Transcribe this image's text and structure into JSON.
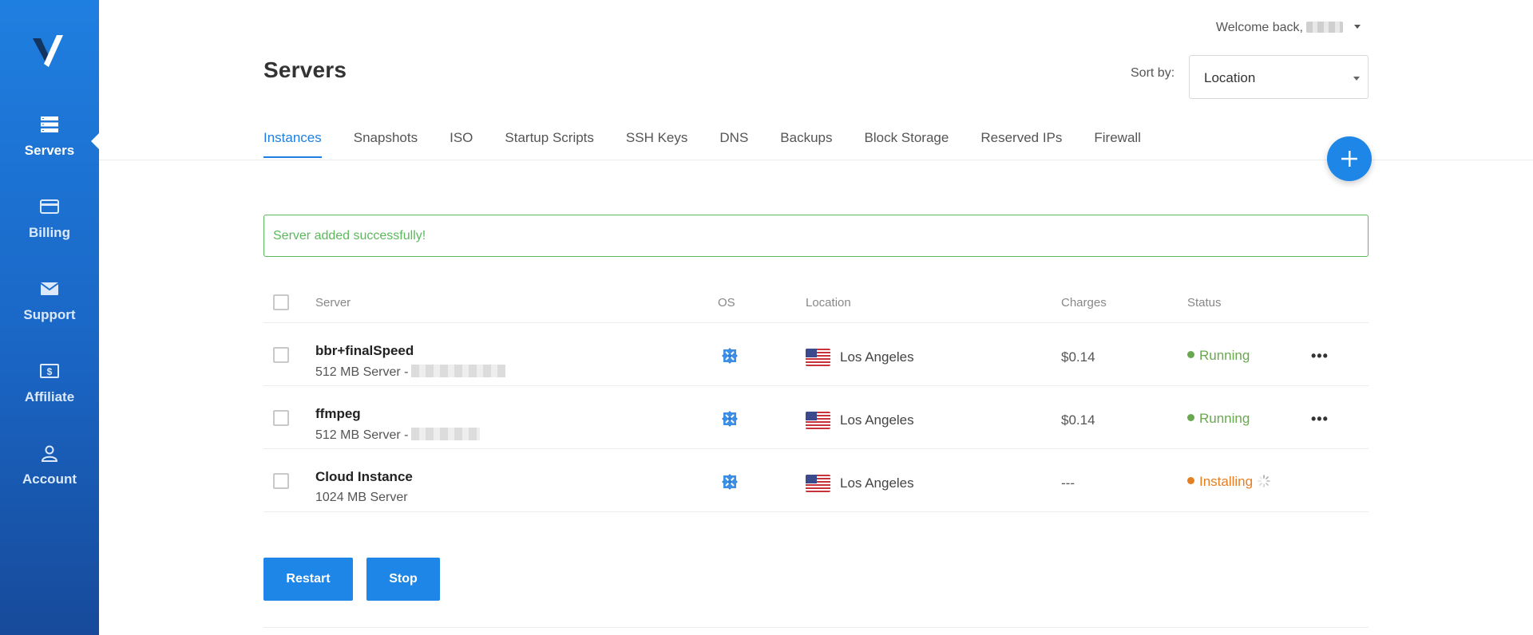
{
  "sidebar": {
    "items": [
      {
        "label": "Servers",
        "icon": "server-icon",
        "active": true
      },
      {
        "label": "Billing",
        "icon": "credit-card-icon"
      },
      {
        "label": "Support",
        "icon": "envelope-icon"
      },
      {
        "label": "Affiliate",
        "icon": "dollar-icon"
      },
      {
        "label": "Account",
        "icon": "user-icon"
      }
    ]
  },
  "header": {
    "welcome": "Welcome back,"
  },
  "page": {
    "title": "Servers",
    "sort_label": "Sort by:",
    "sort_value": "Location"
  },
  "tabs": [
    "Instances",
    "Snapshots",
    "ISO",
    "Startup Scripts",
    "SSH Keys",
    "DNS",
    "Backups",
    "Block Storage",
    "Reserved IPs",
    "Firewall"
  ],
  "alert": {
    "message": "Server added successfully!",
    "color": "#5cb85c"
  },
  "table": {
    "headers": {
      "server": "Server",
      "os": "OS",
      "location": "Location",
      "charges": "Charges",
      "status": "Status"
    },
    "rows": [
      {
        "name": "bbr+finalSpeed",
        "sub": "512 MB Server -",
        "location": "Los Angeles",
        "charges": "$0.14",
        "status": "Running"
      },
      {
        "name": "ffmpeg",
        "sub": "512 MB Server -",
        "location": "Los Angeles",
        "charges": "$0.14",
        "status": "Running"
      },
      {
        "name": "Cloud Instance",
        "sub": "1024 MB Server",
        "location": "Los Angeles",
        "charges": "---",
        "status": "Installing"
      }
    ]
  },
  "actions": {
    "restart": "Restart",
    "stop": "Stop"
  },
  "colors": {
    "accent": "#1e86e6",
    "running": "#6aa84f",
    "installing": "#e67e22"
  }
}
